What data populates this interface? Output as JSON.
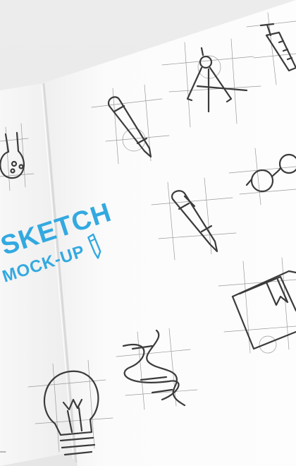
{
  "brand": {
    "line1": "SKETCH",
    "line2": "MOCK-UP",
    "color": "#33a9e0"
  },
  "icons": [
    "flask-icon",
    "pencil-icon",
    "compass-icon",
    "syringe-icon",
    "glasses-icon",
    "pen-icon",
    "book-icon",
    "dna-icon",
    "lightbulb-icon"
  ]
}
